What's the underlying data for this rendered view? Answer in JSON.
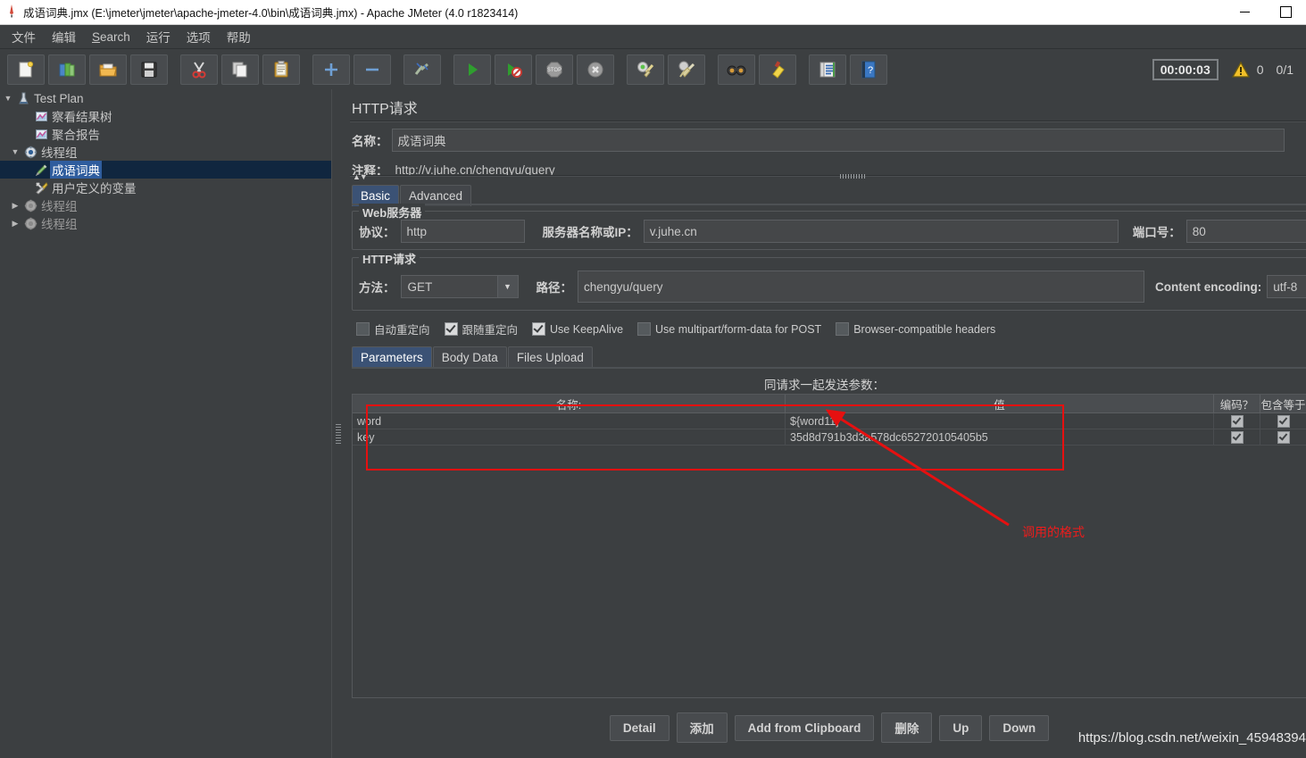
{
  "window": {
    "title": "成语词典.jmx (E:\\jmeter\\jmeter\\apache-jmeter-4.0\\bin\\成语词典.jmx) - Apache JMeter (4.0 r1823414)",
    "app_icon": "jmeter-feather-icon",
    "minimize_label": "—",
    "maximize_label": "□"
  },
  "menu": {
    "items": [
      {
        "label": "文件"
      },
      {
        "label": "编辑"
      },
      {
        "label": "Search",
        "mnemonic": "S"
      },
      {
        "label": "运行"
      },
      {
        "label": "选项"
      },
      {
        "label": "帮助"
      }
    ]
  },
  "toolbar": {
    "buttons": [
      {
        "name": "new-icon",
        "tip": "新建"
      },
      {
        "name": "templates-icon",
        "tip": "模板"
      },
      {
        "name": "open-icon",
        "tip": "打开"
      },
      {
        "name": "save-icon",
        "tip": "保存"
      },
      {
        "name": "cut-icon",
        "tip": "剪切"
      },
      {
        "name": "copy-icon",
        "tip": "复制"
      },
      {
        "name": "paste-icon",
        "tip": "粘贴"
      },
      {
        "name": "expand-all-icon",
        "tip": "展开"
      },
      {
        "name": "collapse-all-icon",
        "tip": "折叠"
      },
      {
        "name": "toggle-icon",
        "tip": "启用/禁用"
      },
      {
        "name": "start-icon",
        "tip": "启动"
      },
      {
        "name": "start-no-timers-icon",
        "tip": "无间隔启动"
      },
      {
        "name": "stop-icon",
        "tip": "停止"
      },
      {
        "name": "shutdown-icon",
        "tip": "关闭"
      },
      {
        "name": "clear-icon",
        "tip": "清除"
      },
      {
        "name": "clear-all-icon",
        "tip": "清除全部"
      },
      {
        "name": "search-icon",
        "tip": "查找"
      },
      {
        "name": "reset-search-icon",
        "tip": "重置查找"
      },
      {
        "name": "function-helper-icon",
        "tip": "函数助手"
      },
      {
        "name": "help-icon",
        "tip": "帮助"
      }
    ],
    "timer": "00:00:03",
    "warning_icon": "warning-triangle-icon",
    "warning_count": "0",
    "thread_count": "0/1"
  },
  "tree": {
    "rows": [
      {
        "label": "Test Plan",
        "depth": 0,
        "toggle": "▼",
        "icon": "test-plan-icon",
        "selected": false
      },
      {
        "label": "察看结果树",
        "depth": 1,
        "toggle": "",
        "icon": "view-results-tree-icon",
        "selected": false
      },
      {
        "label": "聚合报告",
        "depth": 1,
        "toggle": "",
        "icon": "aggregate-report-icon",
        "selected": false
      },
      {
        "label": "线程组",
        "depth": 1,
        "toggle": "▼",
        "icon": "thread-group-icon",
        "selected": false
      },
      {
        "label": "成语词典",
        "depth": 2,
        "toggle": "",
        "icon": "http-sampler-icon",
        "selected": true
      },
      {
        "label": "用户定义的变量",
        "depth": 2,
        "toggle": "",
        "icon": "user-defined-variables-icon",
        "selected": false
      },
      {
        "label": "线程组",
        "depth": 1,
        "toggle": "▶",
        "icon": "thread-group-disabled-icon",
        "selected": false
      },
      {
        "label": "线程组",
        "depth": 1,
        "toggle": "▶",
        "icon": "thread-group-disabled-icon",
        "selected": false
      }
    ]
  },
  "main": {
    "panel_title": "HTTP请求",
    "name_label": "名称：",
    "name_value": "成语词典",
    "comment_label": "注释：",
    "comment_value": "http://v.juhe.cn/chengyu/query",
    "top_tabs": [
      {
        "label": "Basic",
        "active": true
      },
      {
        "label": "Advanced",
        "active": false
      }
    ],
    "web_server": {
      "group_title": "Web服务器",
      "protocol_label": "协议：",
      "protocol_value": "http",
      "server_label": "服务器名称或IP：",
      "server_value": "v.juhe.cn",
      "port_label": "端口号：",
      "port_value": "80"
    },
    "http_request": {
      "group_title": "HTTP请求",
      "method_label": "方法：",
      "method_value": "GET",
      "path_label": "路径：",
      "path_value": "chengyu/query",
      "encoding_label": "Content encoding:",
      "encoding_value": "utf-8"
    },
    "checkboxes": [
      {
        "label": "自动重定向",
        "checked": false
      },
      {
        "label": "跟随重定向",
        "checked": true
      },
      {
        "label": "Use KeepAlive",
        "checked": true
      },
      {
        "label": "Use multipart/form-data for POST",
        "checked": false
      },
      {
        "label": "Browser-compatible headers",
        "checked": false
      }
    ],
    "param_tabs": [
      {
        "label": "Parameters",
        "active": true
      },
      {
        "label": "Body Data",
        "active": false
      },
      {
        "label": "Files Upload",
        "active": false
      }
    ],
    "table_caption": "同请求一起发送参数：",
    "table": {
      "columns": [
        "名称:",
        "值",
        "编码？",
        "包含等于"
      ],
      "rows": [
        {
          "name": "word",
          "value": "${word11}",
          "encode": true,
          "include_equals": true
        },
        {
          "name": "key",
          "value": "35d8d791b3d3a578dc652720105405b5",
          "encode": true,
          "include_equals": true
        }
      ]
    },
    "buttons": [
      {
        "label": "Detail",
        "name": "detail-button"
      },
      {
        "label": "添加",
        "name": "add-button"
      },
      {
        "label": "Add from Clipboard",
        "name": "add-from-clipboard-button"
      },
      {
        "label": "删除",
        "name": "delete-button"
      },
      {
        "label": "Up",
        "name": "up-button"
      },
      {
        "label": "Down",
        "name": "down-button"
      }
    ]
  },
  "annotation": {
    "text": "调用的格式",
    "color": "#ec1c1c"
  },
  "watermark": "https://blog.csdn.net/weixin_45948394"
}
